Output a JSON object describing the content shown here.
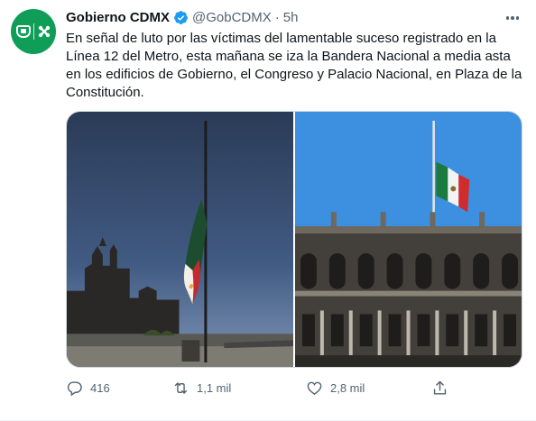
{
  "tweet": {
    "author_name": "Gobierno CDMX",
    "author_handle": "@GobCDMX",
    "separator": "·",
    "timestamp": "5h",
    "text": "En señal de luto por las víctimas del lamentable suceso registrado en la Línea 12 del Metro, esta mañana se iza la Bandera Nacional a media asta en los edificios de Gobierno, el Congreso y Palacio Nacional, en Plaza de la Constitución.",
    "media": [
      {
        "alt": "Bandera Nacional a media asta en el Zócalo con la Catedral al fondo"
      },
      {
        "alt": "Bandera a media asta sobre el edificio de Gobierno"
      }
    ],
    "stats": {
      "replies": "416",
      "retweets": "1,1 mil",
      "likes": "2,8 mil"
    },
    "colors": {
      "avatar_bg": "#0f9d58",
      "verified": "#1d9bf0",
      "secondary_text": "#536471"
    },
    "icons": {
      "verified": "verified-badge-icon",
      "more": "more-options-icon",
      "reply": "reply-icon",
      "retweet": "retweet-icon",
      "like": "heart-icon",
      "share": "share-icon"
    }
  }
}
